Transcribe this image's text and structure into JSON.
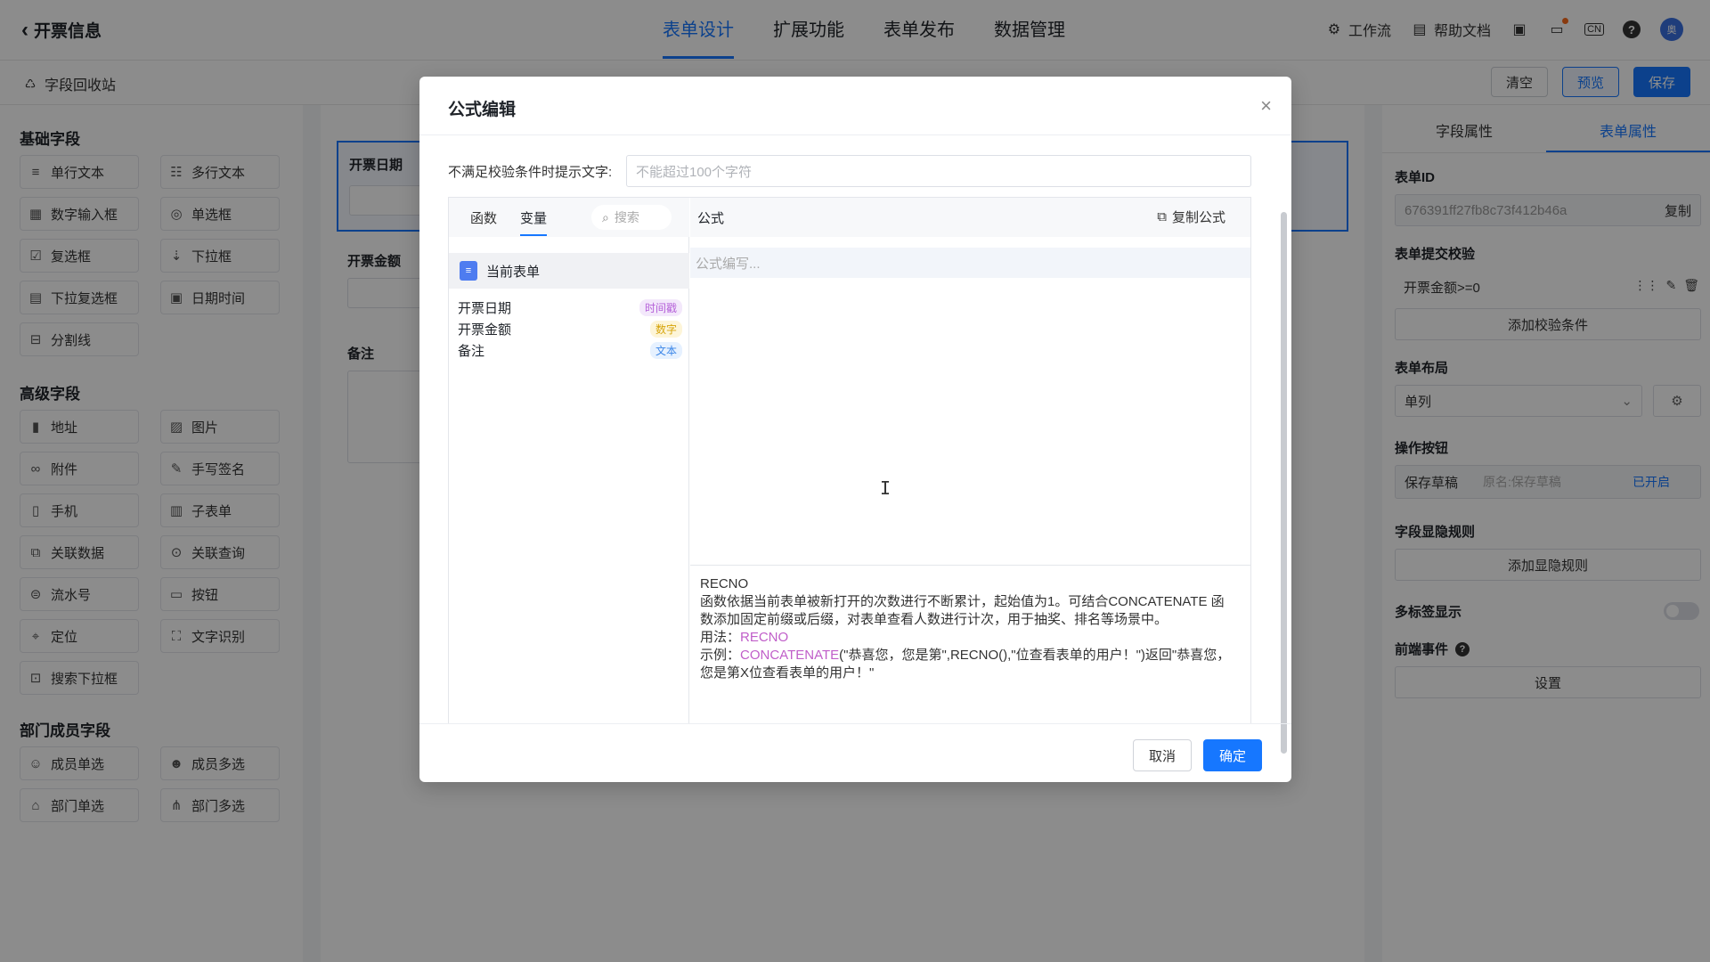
{
  "header": {
    "back_title": "开票信息",
    "tabs": [
      "表单设计",
      "扩展功能",
      "表单发布",
      "数据管理"
    ],
    "workflow": "工作流",
    "help_doc": "帮助文档",
    "lang": "CN",
    "help": "?",
    "avatar": "奥"
  },
  "subbar": {
    "recycle": "字段回收站",
    "clear": "清空",
    "preview": "预览",
    "save": "保存"
  },
  "left": {
    "basic_title": "基础字段",
    "basic": [
      {
        "label": "单行文本",
        "icon": "≡"
      },
      {
        "label": "多行文本",
        "icon": "☷"
      },
      {
        "label": "数字输入框",
        "icon": "▦"
      },
      {
        "label": "单选框",
        "icon": "◎"
      },
      {
        "label": "复选框",
        "icon": "☑"
      },
      {
        "label": "下拉框",
        "icon": "⇣"
      },
      {
        "label": "下拉复选框",
        "icon": "▤"
      },
      {
        "label": "日期时间",
        "icon": "▣"
      },
      {
        "label": "分割线",
        "icon": "⊟"
      }
    ],
    "advanced_title": "高级字段",
    "advanced": [
      {
        "label": "地址",
        "icon": "▮"
      },
      {
        "label": "图片",
        "icon": "▨"
      },
      {
        "label": "附件",
        "icon": "∞"
      },
      {
        "label": "手写签名",
        "icon": "✎"
      },
      {
        "label": "手机",
        "icon": "▯"
      },
      {
        "label": "子表单",
        "icon": "▥"
      },
      {
        "label": "关联数据",
        "icon": "⧉"
      },
      {
        "label": "关联查询",
        "icon": "⊙"
      },
      {
        "label": "流水号",
        "icon": "⊜"
      },
      {
        "label": "按钮",
        "icon": "▭"
      },
      {
        "label": "定位",
        "icon": "⌖"
      },
      {
        "label": "文字识别",
        "icon": "⛶"
      },
      {
        "label": "搜索下拉框",
        "icon": "⊡"
      }
    ],
    "dept_title": "部门成员字段",
    "dept": [
      {
        "label": "成员单选",
        "icon": "☺"
      },
      {
        "label": "成员多选",
        "icon": "☻"
      },
      {
        "label": "部门单选",
        "icon": "⌂"
      },
      {
        "label": "部门多选",
        "icon": "⋔"
      }
    ]
  },
  "canvas": {
    "field1_label": "开票日期",
    "field2_label": "开票金额",
    "field3_label": "备注"
  },
  "right": {
    "tab_field": "字段属性",
    "tab_form": "表单属性",
    "form_id_label": "表单ID",
    "form_id_value": "676391ff27fb8c73f412b46a",
    "copy": "复制",
    "validate_label": "表单提交校验",
    "validate_rule": "开票金额>=0",
    "add_validate": "添加校验条件",
    "layout_label": "表单布局",
    "layout_value": "单列",
    "action_label": "操作按钮",
    "draft_btn": "保存草稿",
    "draft_origin": "原名:保存草稿",
    "draft_status": "已开启",
    "visibility_label": "字段显隐规则",
    "add_visibility": "添加显隐规则",
    "multitab_label": "多标签显示",
    "frontend_label": "前端事件",
    "settings": "设置"
  },
  "modal": {
    "title": "公式编辑",
    "hint_label": "不满足校验条件时提示文字:",
    "hint_placeholder": "不能超过100个字符",
    "tab_func": "函数",
    "tab_var": "变量",
    "search": "搜索",
    "current_form": "当前表单",
    "variables": [
      {
        "name": "开票日期",
        "type": "时间戳",
        "kind": "time"
      },
      {
        "name": "开票金额",
        "type": "数字",
        "kind": "num"
      },
      {
        "name": "备注",
        "type": "文本",
        "kind": "text"
      }
    ],
    "formula_title": "公式",
    "copy_formula": "复制公式",
    "formula_placeholder": "公式编写...",
    "doc_name": "RECNO",
    "doc_desc": "函数依据当前表单被新打开的次数进行不断累计，起始值为1。可结合CONCATENATE 函数添加固定前缀或后缀，对表单查看人数进行计次，用于抽奖、排名等场景中。",
    "usage_label": "用法：",
    "usage_value": "RECNO",
    "example_label": "示例：",
    "example_fn": "CONCATENATE",
    "example_rest": "(\"恭喜您，您是第\",RECNO(),\"位查看表单的用户！\")返回\"恭喜您，您是第X位查看表单的用户！\"",
    "cancel": "取消",
    "ok": "确定"
  }
}
